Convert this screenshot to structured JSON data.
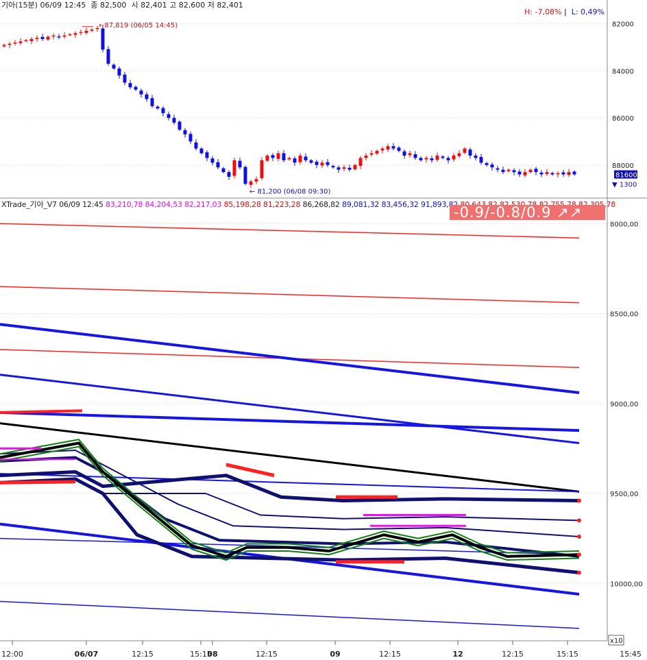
{
  "price_panel": {
    "title": "기아(15분)",
    "datetime": "06/09 12:45",
    "close_label": "종",
    "close": "82,500",
    "open_label": "시",
    "open": "82,401",
    "high_label": "고",
    "high": "82,600",
    "low_label": "저",
    "low": "82,401",
    "hl_high": "H: -7,08%",
    "hl_low": "L: 0,49%",
    "max_annotation": "87,819 (06/05 14:45)",
    "min_annotation": "81,200 (06/08 09:30)",
    "last_price_tag": "81600",
    "volume_tag": "1300",
    "y_ticks": [
      "88000",
      "86000",
      "84000",
      "82000"
    ]
  },
  "indicator_panel": {
    "name": "XTrade_기아_V7",
    "datetime": "06/09 12:45",
    "values_red": "83,210,78 84,204,53 82,217,03",
    "values_dark_red": "85,198,28 81,223,28",
    "values_black": "86,268,82",
    "values_blue": "89,081,32 83,456,32 91,893,82",
    "values_tail": "80,643,82 82,530,78 82,755,78 82,305,78",
    "signal_text": "-0.9/-0.8/0.9 ↗↗",
    "y_ticks": [
      "10000,00",
      "9500,00",
      "9000,00",
      "8500,00",
      "8000,00"
    ]
  },
  "x_axis": {
    "labels": [
      "12:00",
      "06/07",
      "12:15",
      "15:15",
      "08",
      "12:15",
      "09",
      "12:15",
      "12",
      "12:15",
      "15:15",
      "15:45"
    ],
    "zoom_label": "x10"
  },
  "colors": {
    "up": "#e81010",
    "down": "#1010e0",
    "red_line": "#ff2020",
    "blue_line": "#1515e8",
    "navy": "#101070",
    "black": "#000000",
    "green": "#108010",
    "magenta": "#ee10ee"
  },
  "chart_data": [
    {
      "type": "candlestick",
      "ylim": [
        80800,
        88600
      ],
      "y_ticks": [
        82000,
        84000,
        86000,
        88000
      ],
      "ohlc_close_path": [
        87100,
        87150,
        87200,
        87250,
        87300,
        87350,
        87400,
        87350,
        87450,
        87500,
        87450,
        87500,
        87550,
        87600,
        87650,
        87700,
        87750,
        87819,
        86900,
        86300,
        86100,
        85800,
        85500,
        85300,
        85200,
        85000,
        84800,
        84500,
        84400,
        84200,
        84000,
        83800,
        83500,
        83300,
        83000,
        82700,
        82500,
        82300,
        82100,
        81900,
        81700,
        81500,
        82200,
        81900,
        81200,
        81300,
        81400,
        82200,
        82400,
        82300,
        82500,
        82200,
        82300,
        82100,
        82400,
        82200,
        82100,
        82000,
        82100,
        82000,
        81900,
        81800,
        81900,
        81800,
        82000,
        82300,
        82400,
        82500,
        82600,
        82700,
        82800,
        82700,
        82600,
        82400,
        82500,
        82300,
        82200,
        82300,
        82200,
        82400,
        82300,
        82200,
        82400,
        82500,
        82700,
        82400,
        82300,
        82100,
        82000,
        81900,
        81800,
        81700,
        81800,
        81700,
        81600,
        81700,
        81800,
        81700,
        81600,
        81700,
        81600,
        81650,
        81600,
        81700,
        81600
      ]
    },
    {
      "type": "line",
      "ylim": [
        7700,
        10100
      ],
      "y_ticks": [
        8000,
        8500,
        9000,
        9500,
        10000
      ],
      "series": []
    }
  ]
}
